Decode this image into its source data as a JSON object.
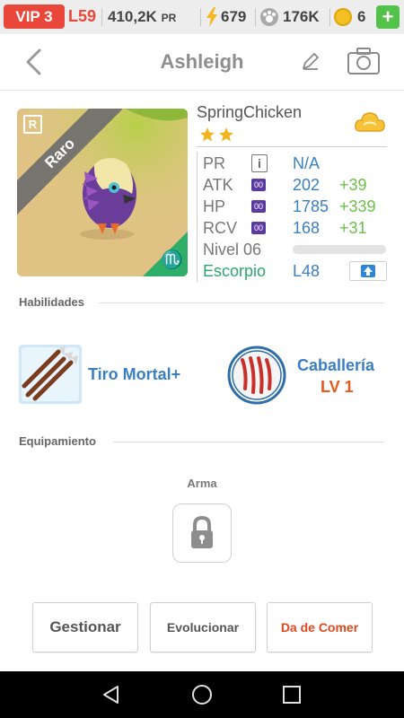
{
  "status": {
    "vip": "VIP 3",
    "level": "L59",
    "power": "410,2K",
    "power_unit": "PR",
    "energy": "679",
    "paws": "176K",
    "coins": "6",
    "add": "+"
  },
  "header": {
    "title": "Ashleigh"
  },
  "monster": {
    "rarity_badge": "R",
    "rarity": "Raro",
    "name": "SpringChicken",
    "stars": 2,
    "zodiac_symbol": "♏"
  },
  "stats": {
    "pr": {
      "label": "PR",
      "value": "N/A"
    },
    "atk": {
      "label": "ATK",
      "value": "202",
      "bonus": "+39"
    },
    "hp": {
      "label": "HP",
      "value": "1785",
      "bonus": "+339"
    },
    "rcv": {
      "label": "RCV",
      "value": "168",
      "bonus": "+31"
    },
    "badge": "00",
    "nivel": "Nivel 06",
    "nivel_progress": 0,
    "sign": "Escorpio",
    "sign_level": "L48"
  },
  "sections": {
    "abilities": "Habilidades",
    "equipment": "Equipamiento"
  },
  "skills": {
    "skill1": "Tiro Mortal+",
    "skill2": "Caballería",
    "skill2_level": "LV 1"
  },
  "equipment": {
    "weapon_label": "Arma"
  },
  "buttons": {
    "manage": "Gestionar",
    "evolve": "Evolucionar",
    "feed": "Da de Comer"
  },
  "colors": {
    "accent_red": "#e8473a",
    "blue": "#3a7fc3",
    "green": "#6cc04a",
    "escorpio": "#28a86a"
  }
}
